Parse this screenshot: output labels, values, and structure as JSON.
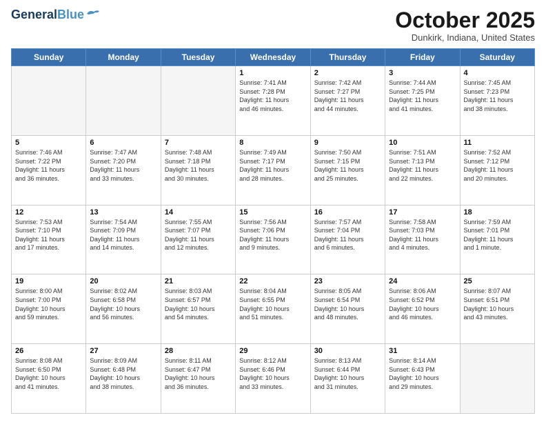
{
  "header": {
    "logo_line1": "General",
    "logo_line2": "Blue",
    "month": "October 2025",
    "location": "Dunkirk, Indiana, United States"
  },
  "weekdays": [
    "Sunday",
    "Monday",
    "Tuesday",
    "Wednesday",
    "Thursday",
    "Friday",
    "Saturday"
  ],
  "weeks": [
    [
      {
        "day": "",
        "info": ""
      },
      {
        "day": "",
        "info": ""
      },
      {
        "day": "",
        "info": ""
      },
      {
        "day": "1",
        "info": "Sunrise: 7:41 AM\nSunset: 7:28 PM\nDaylight: 11 hours\nand 46 minutes."
      },
      {
        "day": "2",
        "info": "Sunrise: 7:42 AM\nSunset: 7:27 PM\nDaylight: 11 hours\nand 44 minutes."
      },
      {
        "day": "3",
        "info": "Sunrise: 7:44 AM\nSunset: 7:25 PM\nDaylight: 11 hours\nand 41 minutes."
      },
      {
        "day": "4",
        "info": "Sunrise: 7:45 AM\nSunset: 7:23 PM\nDaylight: 11 hours\nand 38 minutes."
      }
    ],
    [
      {
        "day": "5",
        "info": "Sunrise: 7:46 AM\nSunset: 7:22 PM\nDaylight: 11 hours\nand 36 minutes."
      },
      {
        "day": "6",
        "info": "Sunrise: 7:47 AM\nSunset: 7:20 PM\nDaylight: 11 hours\nand 33 minutes."
      },
      {
        "day": "7",
        "info": "Sunrise: 7:48 AM\nSunset: 7:18 PM\nDaylight: 11 hours\nand 30 minutes."
      },
      {
        "day": "8",
        "info": "Sunrise: 7:49 AM\nSunset: 7:17 PM\nDaylight: 11 hours\nand 28 minutes."
      },
      {
        "day": "9",
        "info": "Sunrise: 7:50 AM\nSunset: 7:15 PM\nDaylight: 11 hours\nand 25 minutes."
      },
      {
        "day": "10",
        "info": "Sunrise: 7:51 AM\nSunset: 7:13 PM\nDaylight: 11 hours\nand 22 minutes."
      },
      {
        "day": "11",
        "info": "Sunrise: 7:52 AM\nSunset: 7:12 PM\nDaylight: 11 hours\nand 20 minutes."
      }
    ],
    [
      {
        "day": "12",
        "info": "Sunrise: 7:53 AM\nSunset: 7:10 PM\nDaylight: 11 hours\nand 17 minutes."
      },
      {
        "day": "13",
        "info": "Sunrise: 7:54 AM\nSunset: 7:09 PM\nDaylight: 11 hours\nand 14 minutes."
      },
      {
        "day": "14",
        "info": "Sunrise: 7:55 AM\nSunset: 7:07 PM\nDaylight: 11 hours\nand 12 minutes."
      },
      {
        "day": "15",
        "info": "Sunrise: 7:56 AM\nSunset: 7:06 PM\nDaylight: 11 hours\nand 9 minutes."
      },
      {
        "day": "16",
        "info": "Sunrise: 7:57 AM\nSunset: 7:04 PM\nDaylight: 11 hours\nand 6 minutes."
      },
      {
        "day": "17",
        "info": "Sunrise: 7:58 AM\nSunset: 7:03 PM\nDaylight: 11 hours\nand 4 minutes."
      },
      {
        "day": "18",
        "info": "Sunrise: 7:59 AM\nSunset: 7:01 PM\nDaylight: 11 hours\nand 1 minute."
      }
    ],
    [
      {
        "day": "19",
        "info": "Sunrise: 8:00 AM\nSunset: 7:00 PM\nDaylight: 10 hours\nand 59 minutes."
      },
      {
        "day": "20",
        "info": "Sunrise: 8:02 AM\nSunset: 6:58 PM\nDaylight: 10 hours\nand 56 minutes."
      },
      {
        "day": "21",
        "info": "Sunrise: 8:03 AM\nSunset: 6:57 PM\nDaylight: 10 hours\nand 54 minutes."
      },
      {
        "day": "22",
        "info": "Sunrise: 8:04 AM\nSunset: 6:55 PM\nDaylight: 10 hours\nand 51 minutes."
      },
      {
        "day": "23",
        "info": "Sunrise: 8:05 AM\nSunset: 6:54 PM\nDaylight: 10 hours\nand 48 minutes."
      },
      {
        "day": "24",
        "info": "Sunrise: 8:06 AM\nSunset: 6:52 PM\nDaylight: 10 hours\nand 46 minutes."
      },
      {
        "day": "25",
        "info": "Sunrise: 8:07 AM\nSunset: 6:51 PM\nDaylight: 10 hours\nand 43 minutes."
      }
    ],
    [
      {
        "day": "26",
        "info": "Sunrise: 8:08 AM\nSunset: 6:50 PM\nDaylight: 10 hours\nand 41 minutes."
      },
      {
        "day": "27",
        "info": "Sunrise: 8:09 AM\nSunset: 6:48 PM\nDaylight: 10 hours\nand 38 minutes."
      },
      {
        "day": "28",
        "info": "Sunrise: 8:11 AM\nSunset: 6:47 PM\nDaylight: 10 hours\nand 36 minutes."
      },
      {
        "day": "29",
        "info": "Sunrise: 8:12 AM\nSunset: 6:46 PM\nDaylight: 10 hours\nand 33 minutes."
      },
      {
        "day": "30",
        "info": "Sunrise: 8:13 AM\nSunset: 6:44 PM\nDaylight: 10 hours\nand 31 minutes."
      },
      {
        "day": "31",
        "info": "Sunrise: 8:14 AM\nSunset: 6:43 PM\nDaylight: 10 hours\nand 29 minutes."
      },
      {
        "day": "",
        "info": ""
      }
    ]
  ]
}
